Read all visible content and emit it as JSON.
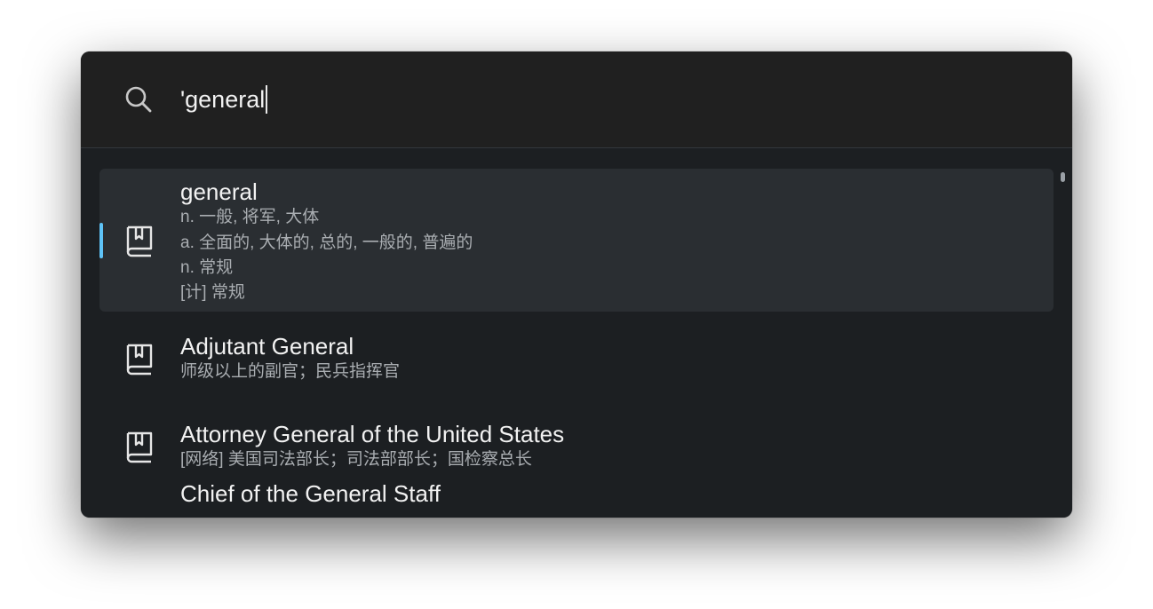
{
  "search": {
    "query": "'general"
  },
  "results": [
    {
      "title": "general",
      "lines": [
        "n. 一般, 将军, 大体",
        "a. 全面的, 大体的, 总的, 一般的, 普遍的",
        "n. 常规",
        "[计] 常规"
      ],
      "icon": "dictionary-book-icon",
      "selected": true
    },
    {
      "title": "Adjutant General",
      "lines": [
        "师级以上的副官；民兵指挥官"
      ],
      "icon": "dictionary-book-icon"
    },
    {
      "title": "Attorney General of the United States",
      "lines": [
        "[网络] 美国司法部长；司法部部长；国检察总长"
      ],
      "icon": "dictionary-book-icon"
    },
    {
      "title": "Chief of the General Staff",
      "lines": [],
      "icon": "dictionary-book-icon"
    }
  ],
  "colors": {
    "accent": "#5ec3f7",
    "background": "#1c1f22",
    "search_background": "#202020",
    "selected_background": "#2a2e32"
  }
}
